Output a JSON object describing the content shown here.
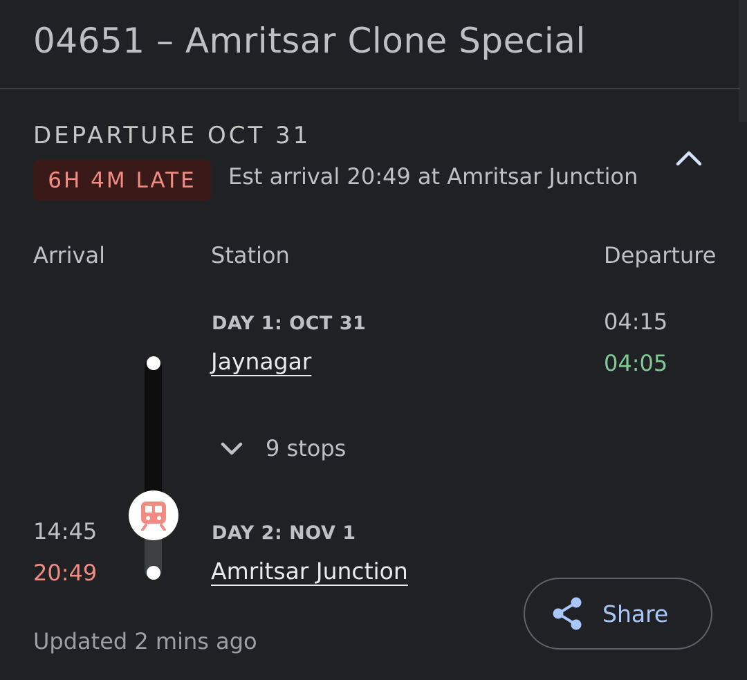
{
  "header": {
    "title": "04651 – Amritsar Clone Special"
  },
  "status": {
    "departure_label": "DEPARTURE OCT 31",
    "late_badge": "6H 4M LATE",
    "est_arrival": "Est arrival 20:49 at Amritsar Junction"
  },
  "columns": {
    "arrival": "Arrival",
    "station": "Station",
    "departure": "Departure"
  },
  "stops": [
    {
      "day": "DAY 1: OCT 31",
      "station": "Jaynagar",
      "arrival_scheduled": "",
      "arrival_actual": "",
      "departure_scheduled": "04:15",
      "departure_actual": "04:05"
    },
    {
      "day": "DAY 2: NOV 1",
      "station": "Amritsar Junction",
      "arrival_scheduled": "14:45",
      "arrival_actual": "20:49",
      "departure_scheduled": "",
      "departure_actual": ""
    }
  ],
  "intermediate": {
    "label": "9 stops"
  },
  "footer": {
    "updated": "Updated 2 mins ago",
    "share_label": "Share"
  },
  "colors": {
    "background": "#202124",
    "late": "#f28b82",
    "on_time": "#81c995",
    "accent": "#a8c7fa"
  },
  "icons": {
    "collapse": "chevron-up-icon",
    "expand_stops": "chevron-down-icon",
    "train": "train-icon",
    "share": "share-icon"
  }
}
